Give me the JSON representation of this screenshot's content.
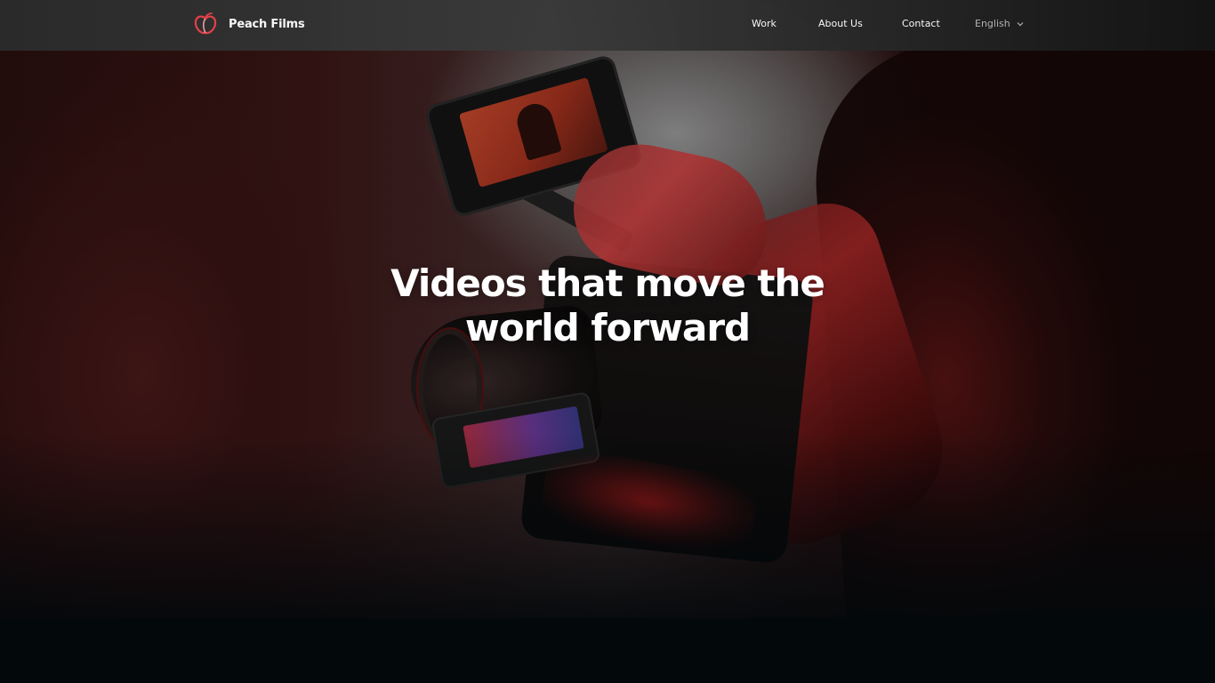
{
  "brand": {
    "name": "Peach Films",
    "logo_icon": "peach-logo-icon",
    "accent_color": "#e8434b"
  },
  "nav": {
    "items": [
      {
        "label": "Work"
      },
      {
        "label": "About Us"
      },
      {
        "label": "Contact"
      }
    ],
    "language": {
      "selected": "English",
      "icon": "chevron-down-icon"
    }
  },
  "hero": {
    "headline_line1": "Videos that move the",
    "headline_line2": "world forward"
  },
  "colors": {
    "header_bg": "#2e2e2e",
    "page_bg": "#03080b",
    "hero_tint": "#3b1616"
  }
}
